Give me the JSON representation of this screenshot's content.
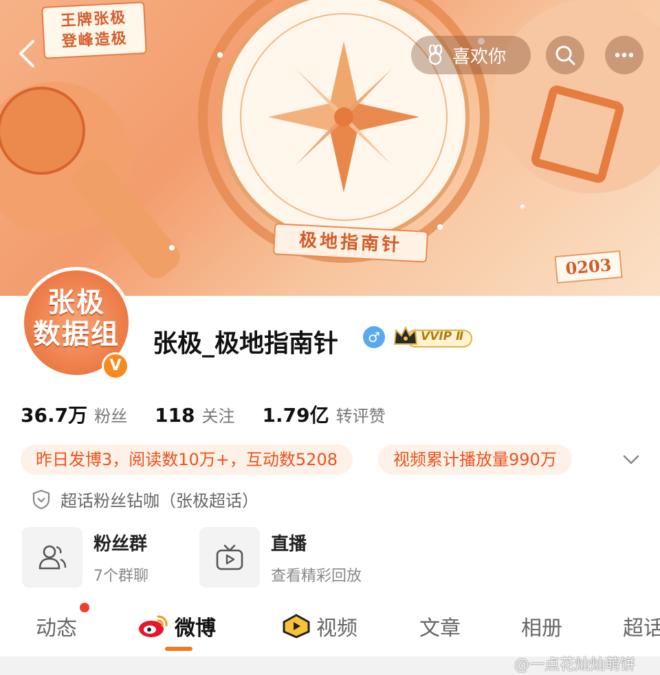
{
  "header": {
    "like_label": "喜欢你",
    "banner_badge_line1": "王牌张极",
    "banner_badge_line2": "登峰造极",
    "banner_ribbon": "极地指南针",
    "banner_date": "0203"
  },
  "profile": {
    "avatar_line1": "张极",
    "avatar_line2": "数据组",
    "verify_mark": "V",
    "username": "张极_极地指南针",
    "gender_symbol": "♂",
    "vip_label": "VVIP Ⅱ"
  },
  "stats": [
    {
      "value": "36.7万",
      "label": "粉丝"
    },
    {
      "value": "118",
      "label": "关注"
    },
    {
      "value": "1.79亿",
      "label": "转评赞"
    }
  ],
  "chips": [
    "昨日发博3，阅读数10万+，互动数5208",
    "视频累计播放量990万"
  ],
  "supertopic": "超话粉丝钻咖（张极超话）",
  "cards": [
    {
      "title": "粉丝群",
      "sub": "7个群聊",
      "icon": "group-icon"
    },
    {
      "title": "直播",
      "sub": "查看精彩回放",
      "icon": "tv-icon"
    }
  ],
  "tabs": [
    "动态",
    "微博",
    "视频",
    "文章",
    "相册",
    "超话"
  ],
  "active_tab": "微博",
  "watermark": "@一点花灿灿萌饼",
  "colors": {
    "accent": "#f27a1a",
    "chip_text": "#e8541f",
    "chip_bg": "#fdf1e8",
    "badge_red": "#f03d2e"
  }
}
